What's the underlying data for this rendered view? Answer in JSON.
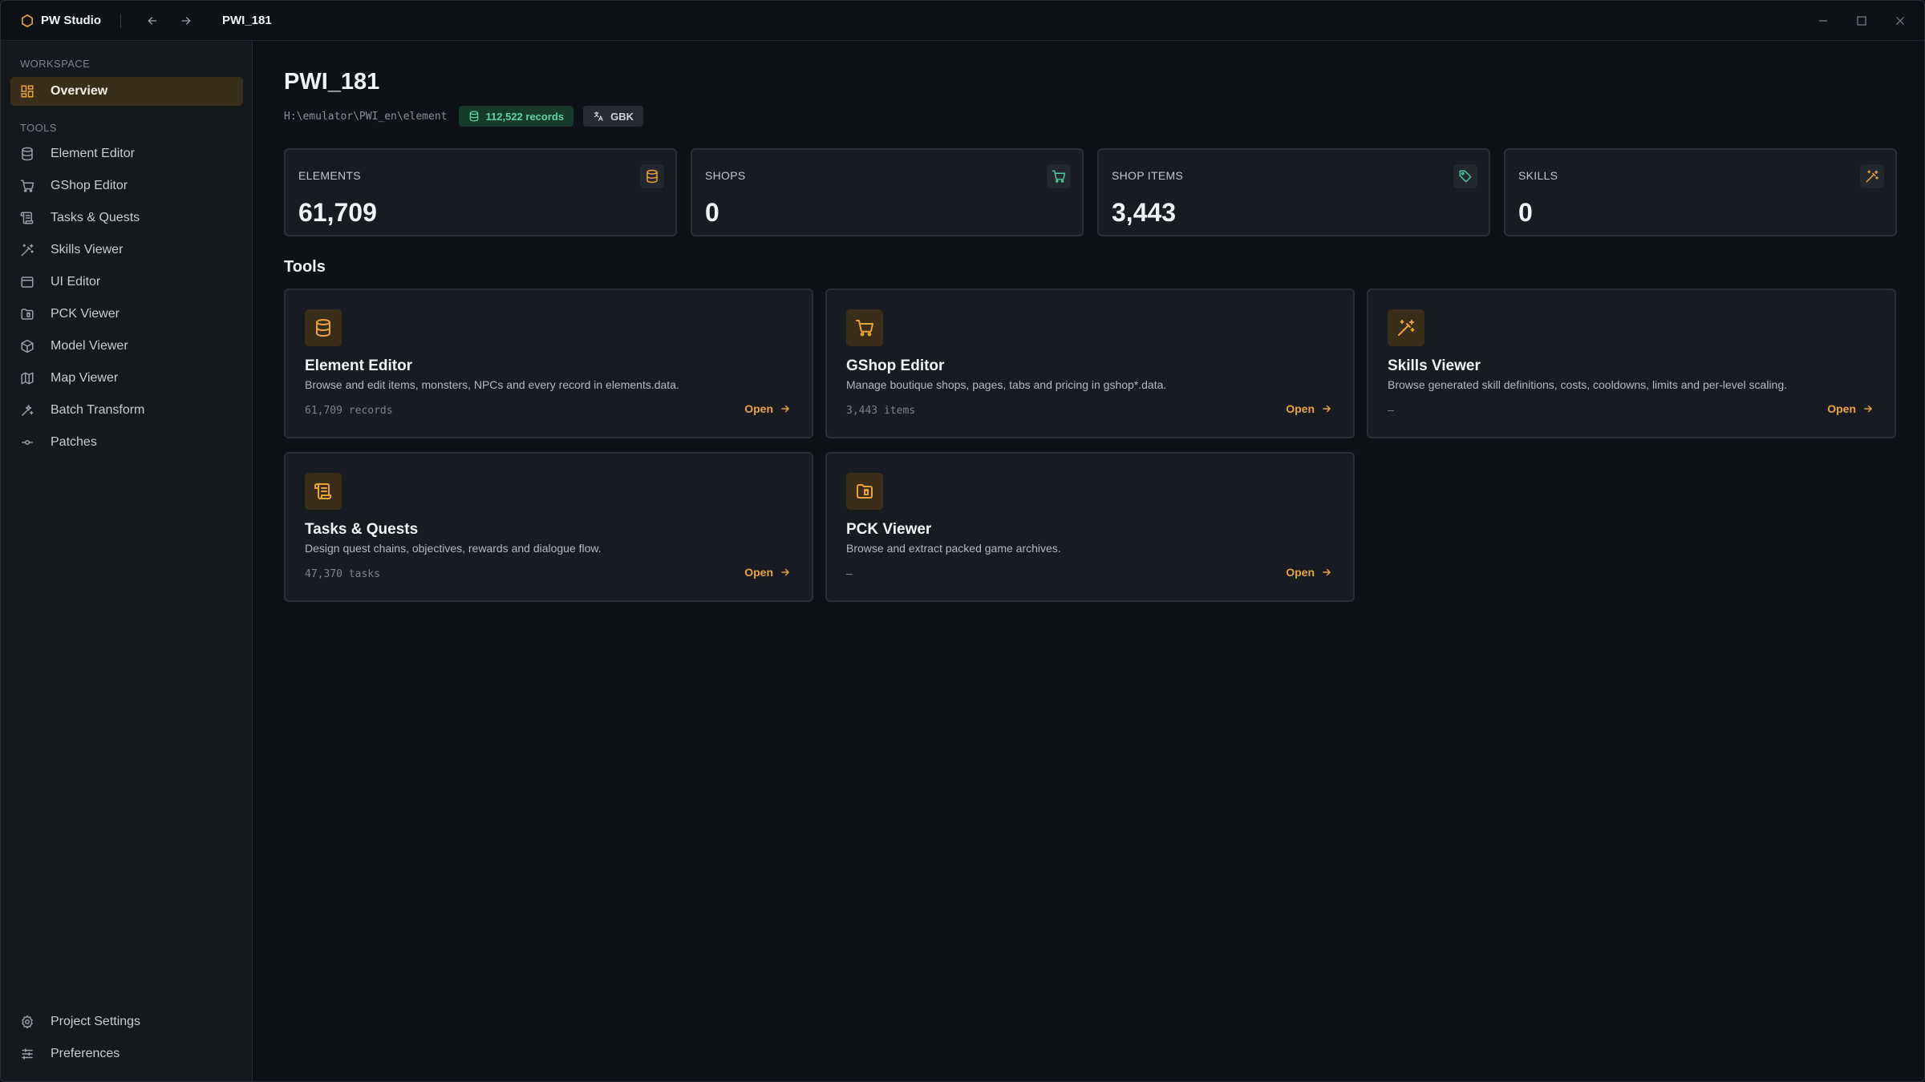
{
  "app": {
    "name": "PW Studio",
    "project_tab": "PWI_181"
  },
  "sidebar": {
    "workspace_label": "WORKSPACE",
    "tools_label": "TOOLS",
    "workspace_items": [
      {
        "label": "Overview",
        "icon": "grid-icon",
        "active": true
      }
    ],
    "tool_items": [
      {
        "label": "Element Editor",
        "icon": "database-icon"
      },
      {
        "label": "GShop Editor",
        "icon": "cart-icon"
      },
      {
        "label": "Tasks & Quests",
        "icon": "scroll-icon"
      },
      {
        "label": "Skills Viewer",
        "icon": "magic-wand-icon"
      },
      {
        "label": "UI Editor",
        "icon": "window-icon"
      },
      {
        "label": "PCK Viewer",
        "icon": "folder-archive-icon"
      },
      {
        "label": "Model Viewer",
        "icon": "cube-icon"
      },
      {
        "label": "Map Viewer",
        "icon": "map-icon"
      },
      {
        "label": "Batch Transform",
        "icon": "sparkles-icon"
      },
      {
        "label": "Patches",
        "icon": "commit-icon"
      }
    ],
    "bottom_items": [
      {
        "label": "Project Settings",
        "icon": "gear-icon"
      },
      {
        "label": "Preferences",
        "icon": "sliders-icon"
      }
    ]
  },
  "overview": {
    "title": "PWI_181",
    "path": "H:\\emulator\\PWI_en\\element",
    "records_badge": "112,522 records",
    "encoding_badge": "GBK"
  },
  "stats": [
    {
      "label": "ELEMENTS",
      "value": "61,709",
      "icon": "database-icon",
      "icon_color": "#e8a33d"
    },
    {
      "label": "SHOPS",
      "value": "0",
      "icon": "cart-icon",
      "icon_color": "#4fc99a"
    },
    {
      "label": "SHOP ITEMS",
      "value": "3,443",
      "icon": "tag-icon",
      "icon_color": "#4fc99a"
    },
    {
      "label": "SKILLS",
      "value": "0",
      "icon": "magic-wand-icon",
      "icon_color": "#e8a33d"
    }
  ],
  "tools_section": {
    "title": "Tools",
    "open_label": "Open",
    "cards": [
      {
        "name": "Element Editor",
        "desc": "Browse and edit items, monsters, NPCs and every record in elements.data.",
        "meta": "61,709 records",
        "icon": "database-icon"
      },
      {
        "name": "GShop Editor",
        "desc": "Manage boutique shops, pages, tabs and pricing in gshop*.data.",
        "meta": "3,443 items",
        "icon": "cart-icon"
      },
      {
        "name": "Skills Viewer",
        "desc": "Browse generated skill definitions, costs, cooldowns, limits and per-level scaling.",
        "meta": "—",
        "icon": "magic-wand-icon"
      },
      {
        "name": "Tasks & Quests",
        "desc": "Design quest chains, objectives, rewards and dialogue flow.",
        "meta": "47,370 tasks",
        "icon": "scroll-icon"
      },
      {
        "name": "PCK Viewer",
        "desc": "Browse and extract packed game archives.",
        "meta": "—",
        "icon": "folder-archive-icon"
      }
    ]
  },
  "colors": {
    "accent": "#e8a33d",
    "success": "#4fc99a",
    "background": "#0e1116",
    "sidebar": "#15181d",
    "card": "#181b21"
  }
}
